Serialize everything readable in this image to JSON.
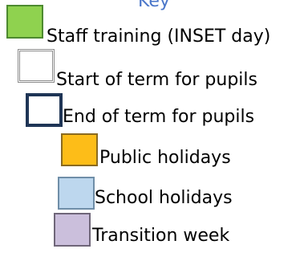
{
  "key": {
    "title": "Key",
    "items": [
      {
        "label": "Staff training (INSET day)",
        "swatch_fill": "#8fd24f",
        "swatch_border": "#4d8a2f"
      },
      {
        "label": "Start of term for pupils",
        "swatch_fill": "#ffffff",
        "swatch_border": "#8c8c8c"
      },
      {
        "label": "End of term for pupils",
        "swatch_fill": "#ffffff",
        "swatch_border": "#1f3556"
      },
      {
        "label": "Public holidays",
        "swatch_fill": "#fdbd18",
        "swatch_border": "#8a6a20"
      },
      {
        "label": "School holidays",
        "swatch_fill": "#bdd7ee",
        "swatch_border": "#6f8ea8"
      },
      {
        "label": "Transition week",
        "swatch_fill": "#cbbfdc",
        "swatch_border": "#6f6679"
      }
    ]
  }
}
